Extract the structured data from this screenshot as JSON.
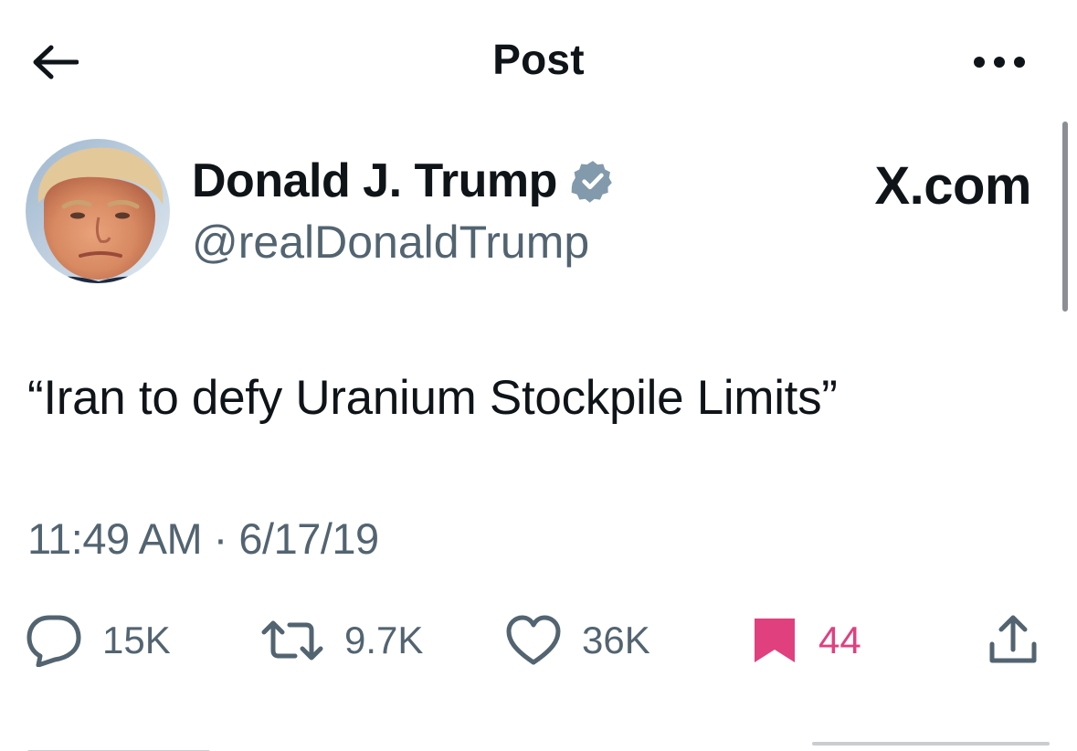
{
  "header": {
    "title": "Post",
    "back_icon": "arrow-left-icon",
    "more_icon": "more-horizontal-icon"
  },
  "author": {
    "name": "Donald J. Trump",
    "handle": "@realDonaldTrump",
    "verified_icon": "verified-badge-icon",
    "verified_color": "#829aab"
  },
  "source_label": "X.com",
  "post": {
    "text": "“Iran to defy Uranium Stockpile Limits”",
    "time": "11:49 AM",
    "separator": " · ",
    "date": "6/17/19"
  },
  "actions": {
    "reply": {
      "icon": "reply-bubble-icon",
      "count": "15K"
    },
    "repost": {
      "icon": "repost-icon",
      "count": "9.7K"
    },
    "like": {
      "icon": "heart-icon",
      "count": "36K"
    },
    "bookmark": {
      "icon": "bookmark-icon",
      "count": "44",
      "color": "#e0407e",
      "active": true
    },
    "share": {
      "icon": "share-icon"
    }
  },
  "colors": {
    "text_primary": "#0f1419",
    "text_secondary": "#536471",
    "bookmark_active": "#e0407e"
  }
}
